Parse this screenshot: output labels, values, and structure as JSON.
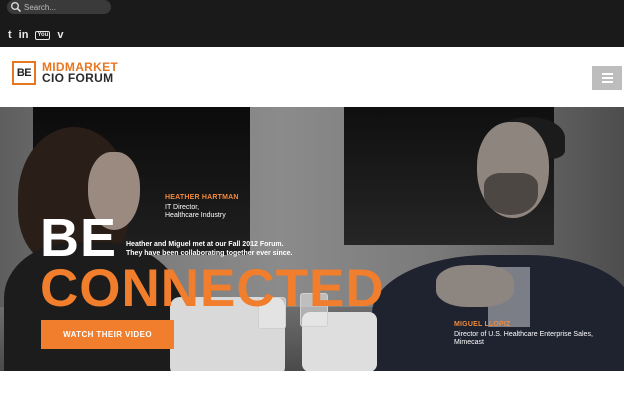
{
  "search": {
    "placeholder": "Search..."
  },
  "social": [
    {
      "name": "twitter",
      "glyph": "t"
    },
    {
      "name": "linkedin",
      "glyph": "in"
    },
    {
      "name": "youtube",
      "glyph": "You"
    },
    {
      "name": "vimeo",
      "glyph": "v"
    }
  ],
  "logo": {
    "mark": "BE",
    "line1": "MIDMARKET",
    "line2": "CIO FORUM"
  },
  "hero": {
    "person1": {
      "name": "HEATHER HARTMAN",
      "role_line1": "IT Director,",
      "role_line2": "Healthcare Industry"
    },
    "person2": {
      "name": "MIGUEL LLOPIZ",
      "role_line1": "Director of U.S. Healthcare Enterprise Sales,",
      "role_line2": "Mimecast"
    },
    "tagline_line1": "Heather and Miguel met at our Fall 2012 Forum.",
    "tagline_line2": "They have been collaborating together ever since.",
    "headline_line1": "BE",
    "headline_line2": "CONNECTED",
    "cta_label": "WATCH THEIR VIDEO"
  },
  "colors": {
    "accent": "#f07e2d",
    "topbar": "#1a1a1a",
    "menu_button": "#bdbdbd"
  }
}
